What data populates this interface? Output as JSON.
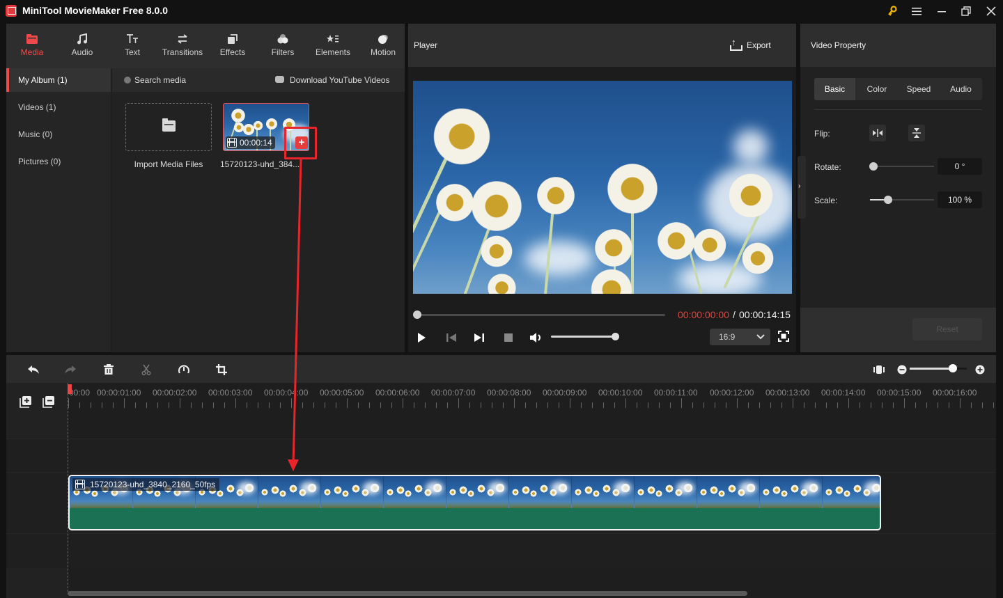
{
  "app": {
    "title": "MiniTool MovieMaker Free 8.0.0",
    "icons": [
      "key-icon",
      "menu-icon",
      "minimize-icon",
      "maximize-icon",
      "close-icon"
    ]
  },
  "media_tabs": [
    {
      "label": "Media",
      "icon": "media-folder-icon",
      "active": true
    },
    {
      "label": "Audio",
      "icon": "music-note-icon",
      "active": false
    },
    {
      "label": "Text",
      "icon": "text-icon",
      "active": false
    },
    {
      "label": "Transitions",
      "icon": "transitions-icon",
      "active": false
    },
    {
      "label": "Effects",
      "icon": "effects-icon",
      "active": false
    },
    {
      "label": "Filters",
      "icon": "filters-icon",
      "active": false
    },
    {
      "label": "Elements",
      "icon": "elements-icon",
      "active": false
    },
    {
      "label": "Motion",
      "icon": "motion-icon",
      "active": false
    }
  ],
  "albums": [
    {
      "label": "My Album (1)",
      "active": true
    },
    {
      "label": "Videos (1)",
      "active": false
    },
    {
      "label": "Music (0)",
      "active": false
    },
    {
      "label": "Pictures (0)",
      "active": false
    }
  ],
  "media": {
    "search_placeholder": "Search media",
    "download_label": "Download YouTube Videos",
    "import_label": "Import Media Files",
    "items": [
      {
        "name": "15720123-uhd_384...",
        "duration": "00:00:14",
        "add_label": "+"
      }
    ]
  },
  "player": {
    "title": "Player",
    "export_label": "Export",
    "current_time": "00:00:00:00",
    "separator": "/",
    "total_time": "00:00:14:15",
    "progress": 0,
    "volume": 1.0,
    "aspect_ratio": "16:9"
  },
  "property": {
    "title": "Video Property",
    "tabs": [
      {
        "label": "Basic",
        "active": true
      },
      {
        "label": "Color",
        "active": false
      },
      {
        "label": "Speed",
        "active": false
      },
      {
        "label": "Audio",
        "active": false
      }
    ],
    "flip_label": "Flip:",
    "rotate_label": "Rotate:",
    "rotate_value": "0 °",
    "rotate_fraction": 0.0,
    "scale_label": "Scale:",
    "scale_value": "100 %",
    "scale_fraction": 0.28,
    "reset_label": "Reset"
  },
  "timeline": {
    "zoom_fraction": 0.75,
    "ruler_labels": [
      "00:00",
      "00:00:01:00",
      "00:00:02:00",
      "00:00:03:00",
      "00:00:04:00",
      "00:00:05:00",
      "00:00:06:00",
      "00:00:07:00",
      "00:00:08:00",
      "00:00:09:00",
      "00:00:10:00",
      "00:00:11:00",
      "00:00:12:00",
      "00:00:13:00",
      "00:00:14:00",
      "00:00:15:00",
      "00:00:16:00"
    ],
    "clip": {
      "name": "15720123-uhd_3840_2160_50fps",
      "duration_seconds": 14.6
    }
  },
  "colors": {
    "accent": "#ef4a4a",
    "clip_audio": "#1b7153",
    "time_current": "#d9463f",
    "annotation": "#e8252a"
  }
}
